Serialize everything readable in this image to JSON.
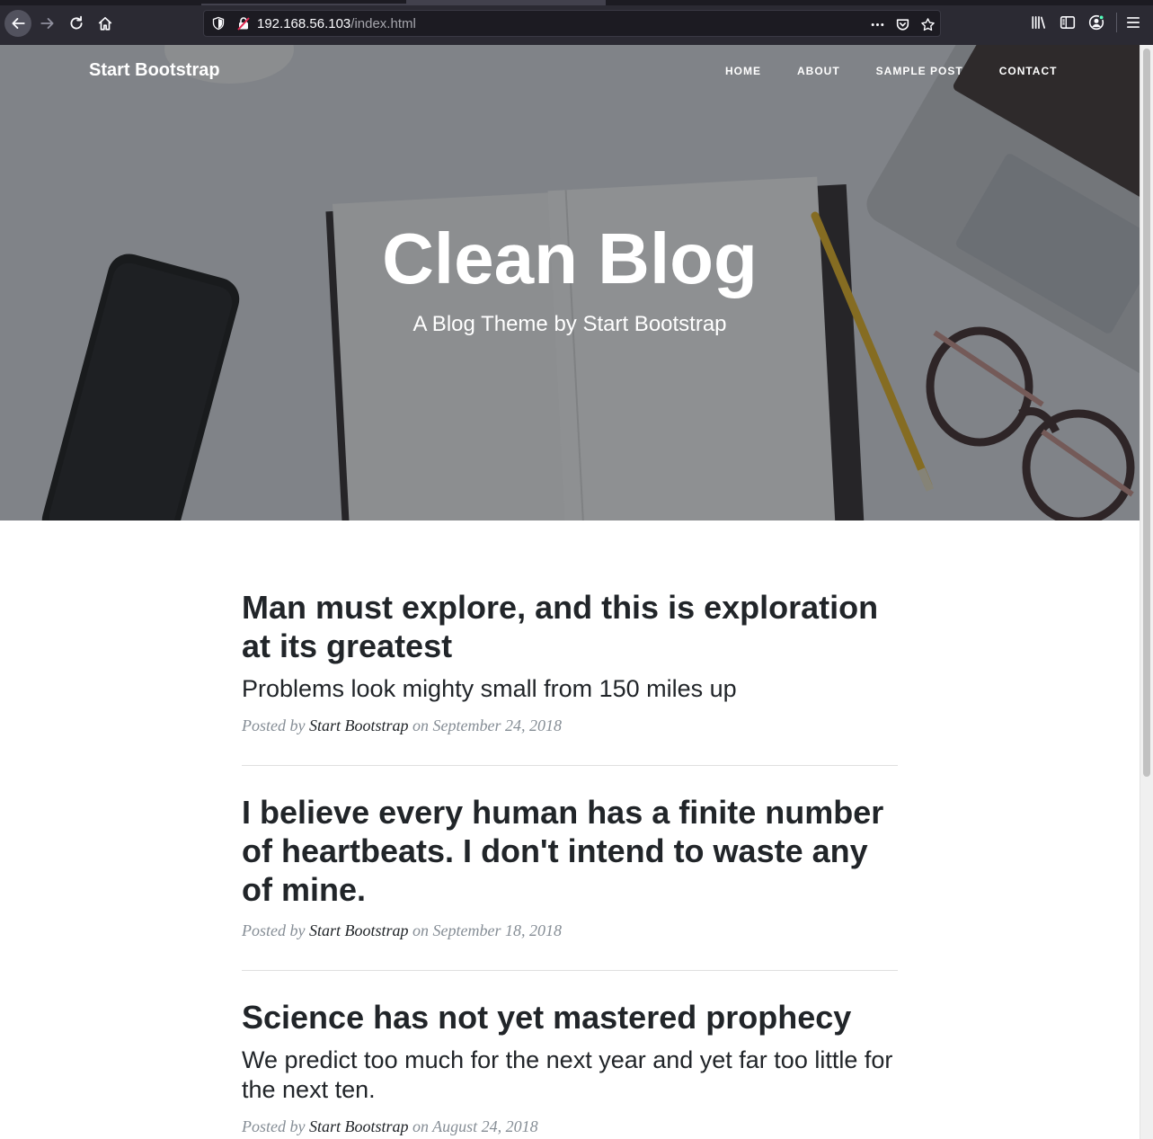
{
  "browser": {
    "url_host": "192.168.56.103",
    "url_path": "/index.html"
  },
  "nav": {
    "brand": "Start Bootstrap",
    "links": [
      "HOME",
      "ABOUT",
      "SAMPLE POST",
      "CONTACT"
    ]
  },
  "header": {
    "title": "Clean Blog",
    "subtitle": "A Blog Theme by Start Bootstrap"
  },
  "posts": [
    {
      "title": "Man must explore, and this is exploration at its greatest",
      "subtitle": "Problems look mighty small from 150 miles up",
      "posted_by": "Posted by",
      "author": "Start Bootstrap",
      "on": "on September 24, 2018"
    },
    {
      "title": "I believe every human has a finite number of heartbeats. I don't intend to waste any of mine.",
      "subtitle": "",
      "posted_by": "Posted by",
      "author": "Start Bootstrap",
      "on": "on September 18, 2018"
    },
    {
      "title": "Science has not yet mastered prophecy",
      "subtitle": "We predict too much for the next year and yet far too little for the next ten.",
      "posted_by": "Posted by",
      "author": "Start Bootstrap",
      "on": "on August 24, 2018"
    }
  ],
  "colors": {
    "chrome": "#2b2a33",
    "text": "#212529",
    "meta": "#868e96"
  }
}
